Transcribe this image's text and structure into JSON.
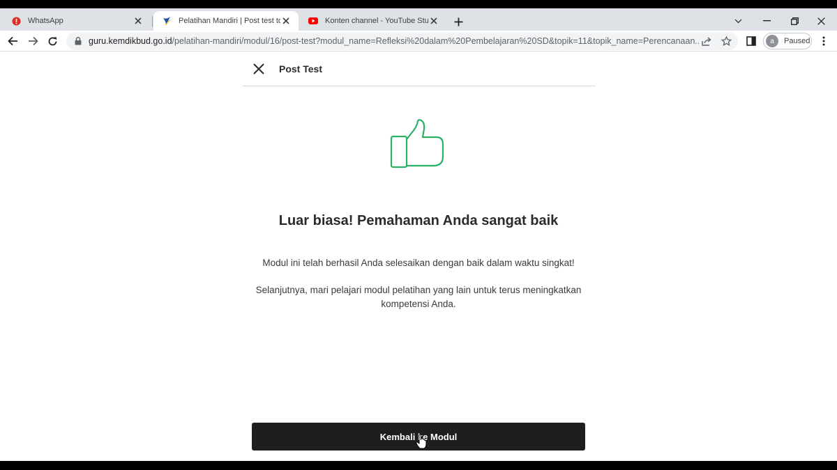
{
  "browser": {
    "tabs": [
      {
        "title": "WhatsApp",
        "icon": "whatsapp-alert-icon"
      },
      {
        "title": "Pelatihan Mandiri | Post test topik",
        "icon": "kemdikbud-logo-icon"
      },
      {
        "title": "Konten channel - YouTube Studio",
        "icon": "youtube-icon"
      }
    ],
    "address_bar": {
      "host": "guru.kemdikbud.go.id",
      "path": "/pelatihan-mandiri/modul/16/post-test?modul_name=Refleksi%20dalam%20Pembelajaran%20SD&topik=11&topik_name=Perencanaan..."
    },
    "profile": {
      "initial": "a",
      "status": "Paused"
    }
  },
  "page": {
    "header_title": "Post Test",
    "heading": "Luar biasa! Pemahaman Anda sangat baik",
    "message_1": "Modul ini telah berhasil Anda selesaikan dengan baik dalam waktu singkat!",
    "message_2": "Selanjutnya, mari pelajari modul pelatihan yang lain untuk terus meningkatkan kompetensi Anda.",
    "button_label": "Kembali ke Modul"
  },
  "colors": {
    "thumb_stroke": "#2bae66",
    "button_bg": "#1e1e1e",
    "tabstrip_bg": "#dee1e6"
  }
}
